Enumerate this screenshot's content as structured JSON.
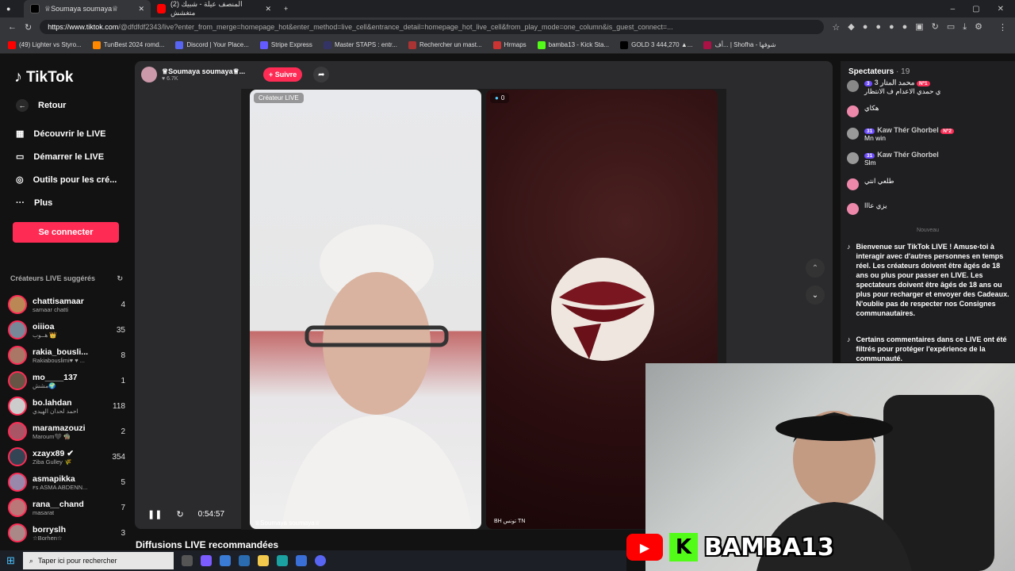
{
  "browser": {
    "tabs": [
      {
        "title": "♕Soumaya soumaya♕",
        "active": true
      },
      {
        "title": "(2) المنصف عيلة - شبيك متغشش",
        "active": false
      }
    ],
    "url_domain": "https://www.tiktok.com",
    "url_path": "/@dfdfdf2343/live?enter_from_merge=homepage_hot&enter_method=live_cell&entrance_detail=homepage_hot_live_cell&from_play_mode=one_column&is_guest_connect=...",
    "bookmarks": [
      "(49) Lighter vs Styro...",
      "TunBest 2024 romd...",
      "Discord | Your Place...",
      "Stripe Express",
      "Master STAPS : entr...",
      "Rechercher un mast...",
      "Hrmaps",
      "bamba13 - Kick Sta...",
      "GOLD 3 444,270 ▲...",
      "أف... | Shofha - شوفها"
    ]
  },
  "sidebar": {
    "logo": "TikTok",
    "back": "Retour",
    "nav": [
      "Découvrir le LIVE",
      "Démarrer le LIVE",
      "Outils pour les cré...",
      "Plus"
    ],
    "login": "Se connecter",
    "suggested_title": "Créateurs LIVE suggérés",
    "creators": [
      {
        "name": "chattisamaar",
        "sub": "samaar chatti",
        "count": "4"
      },
      {
        "name": "oiiioa",
        "sub": "هــوب 👑",
        "count": "35"
      },
      {
        "name": "rakia_bousli...",
        "sub": "Rakiabouslimi♥ ♥ ...",
        "count": "8"
      },
      {
        "name": "mo____137",
        "sub": "مشش🌍",
        "count": "1"
      },
      {
        "name": "bo.lahdan",
        "sub": "احمد لحدان الهيدي",
        "count": "118"
      },
      {
        "name": "maramazouzi",
        "sub": "Maroum🖤 🧌",
        "count": "2"
      },
      {
        "name": "xzayx89 ✔",
        "sub": "Ziba Gulley 🌾",
        "count": "354"
      },
      {
        "name": "asmapikka",
        "sub": "ꜰꜱ ASMA ABDENN...",
        "count": "5"
      },
      {
        "name": "rana__chand",
        "sub": "masarat",
        "count": "7"
      },
      {
        "name": "borryslh",
        "sub": "☆Borhen☆",
        "count": "3"
      }
    ]
  },
  "live": {
    "host_name": "♕Soumaya soumaya♕...",
    "host_likes": "♥ 6.7K",
    "follow": "+ Suivre",
    "creator_tag": "Créateur LIVE",
    "guest_count": "0",
    "host_label": "♕Soumaya soumaya♕",
    "guest_label": "BH تونس TN",
    "timer": "0:54:57",
    "recommended": "Diffusions LIVE recommandées"
  },
  "chat": {
    "title": "Spectateurs",
    "viewers": "· 19",
    "messages": [
      {
        "user": "محمد المنار 3",
        "badge": "3",
        "rank": "Nº1",
        "text": "ي حمدي الاعدام ف الانتظار"
      },
      {
        "user": "",
        "badge": "",
        "rank": "",
        "text": "هكاي"
      },
      {
        "user": "Kaw Thér Ghorbel",
        "badge": "31",
        "rank": "Nº2",
        "text": "Mn win"
      },
      {
        "user": "Kaw Thér Ghorbel",
        "badge": "31",
        "rank": "",
        "text": "Slm"
      },
      {
        "user": "",
        "badge": "",
        "rank": "",
        "text": "طلعي انتي"
      },
      {
        "user": "",
        "badge": "",
        "rank": "",
        "text": "يزي عااا"
      }
    ],
    "new_label": "Nouveau",
    "system1": "Bienvenue sur TikTok LIVE ! Amuse-toi à interagir avec d'autres personnes en temps réel. Les créateurs doivent être âgés de 18 ans ou plus pour passer en LIVE. Les spectateurs doivent être âgés de 18 ans ou plus pour recharger et envoyer des Cadeaux. N'oublie pas de respecter nos Consignes communautaires.",
    "system2": "Certains commentaires dans ce LIVE ont été filtrés pour protéger l'expérience de la communauté."
  },
  "overlay": {
    "brand": "BAMBA13"
  },
  "taskbar": {
    "search": "Taper ici pour rechercher"
  }
}
